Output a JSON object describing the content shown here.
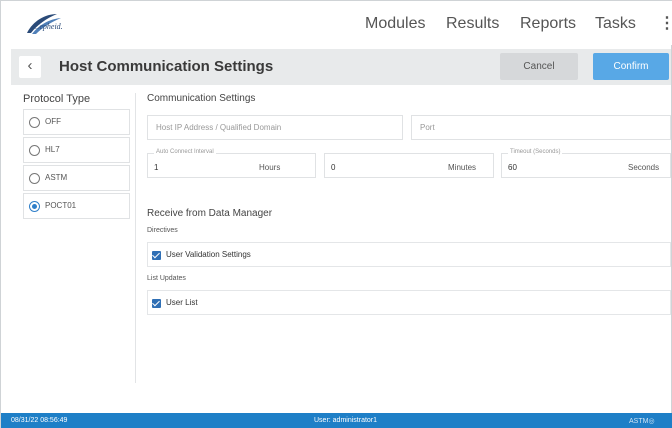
{
  "brand": {
    "logo_text": "Cepheid."
  },
  "nav": {
    "items": [
      "Modules",
      "Results",
      "Reports",
      "Tasks"
    ],
    "more": "⋮"
  },
  "header": {
    "back": "‹",
    "title": "Host Communication Settings",
    "cancel_label": "Cancel",
    "confirm_label": "Confirm"
  },
  "protocol": {
    "title": "Protocol Type",
    "options": [
      "OFF",
      "HL7",
      "ASTM",
      "POCT01"
    ],
    "selected": "POCT01"
  },
  "comm": {
    "title": "Communication Settings",
    "host_placeholder": "Host IP Address / Qualified Domain",
    "port_placeholder": "Port",
    "auto_connect_label": "Auto Connect Interval",
    "hours_value": "1",
    "hours_unit": "Hours",
    "minutes_value": "0",
    "minutes_unit": "Minutes",
    "timeout_label": "Timeout (Seconds)",
    "timeout_value": "60",
    "seconds_unit": "Seconds"
  },
  "receive": {
    "title": "Receive from Data Manager",
    "directives_label": "Directives",
    "user_validation": "User Validation Settings",
    "list_updates_label": "List Updates",
    "user_list": "User List"
  },
  "status": {
    "datetime": "08/31/22 08:56:49",
    "user": "User: administrator1",
    "right": "ASTM◎"
  },
  "colors": {
    "accent": "#58a8e6",
    "statusbar": "#1e7fc7",
    "checkbox": "#2f6fb5"
  }
}
